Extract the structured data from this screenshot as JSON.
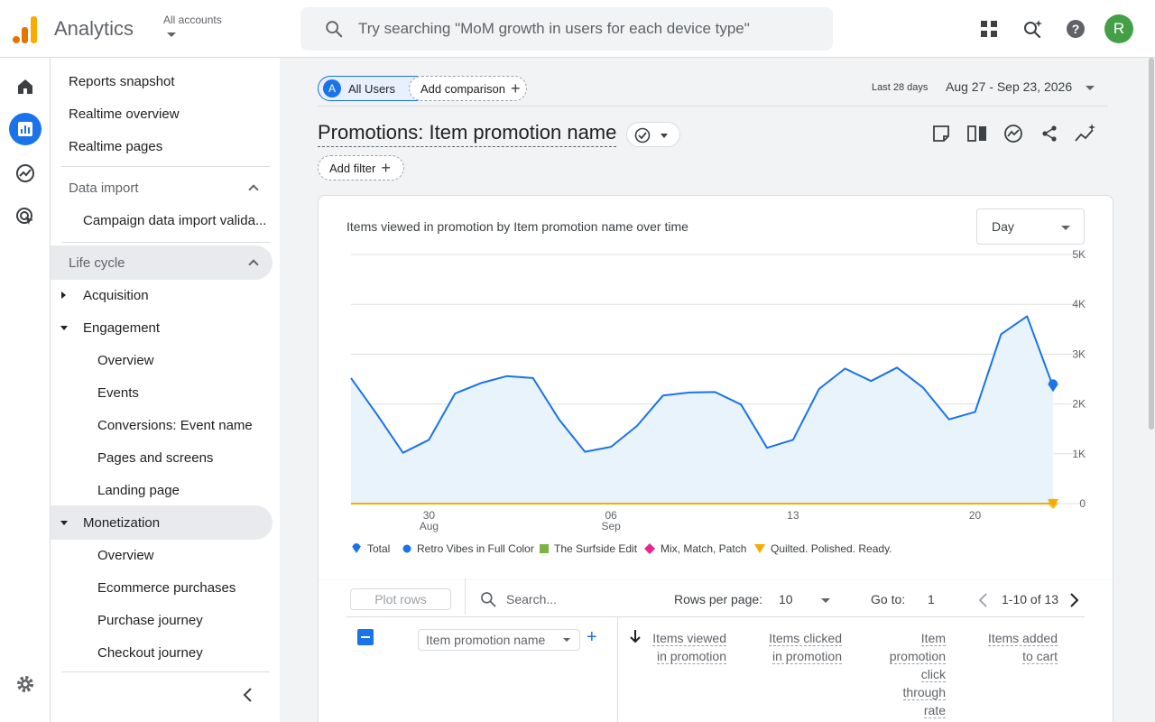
{
  "header": {
    "app_title": "Analytics",
    "accounts_label": "All accounts",
    "search_placeholder": "Try searching \"MoM growth in users for each device type\"",
    "avatar_initial": "R",
    "icons": [
      "apps-grid-icon",
      "search-insights-icon",
      "help-icon"
    ]
  },
  "rail": {
    "items": [
      "home-icon",
      "reports-icon",
      "explore-icon",
      "advertising-icon",
      "settings-icon"
    ],
    "active": "reports-icon"
  },
  "nav": {
    "top_items": [
      "Reports snapshot",
      "Realtime overview",
      "Realtime pages"
    ],
    "data_import_title": "Data import",
    "data_import_items": [
      "Campaign data import valida..."
    ],
    "lifecycle_title": "Life cycle",
    "acquisition": "Acquisition",
    "engagement": "Engagement",
    "engagement_items": [
      "Overview",
      "Events",
      "Conversions: Event name",
      "Pages and screens",
      "Landing page"
    ],
    "monetization": "Monetization",
    "monetization_items": [
      "Overview",
      "Ecommerce purchases",
      "Purchase journey",
      "Checkout journey"
    ]
  },
  "toolbar": {
    "segment_letter": "A",
    "segment_label": "All Users",
    "add_comparison": "Add comparison",
    "date_range_label": "Last 28 days",
    "date_range": "Aug 27 - Sep 23, 2026",
    "report_title": "Promotions: Item promotion name",
    "add_filter": "Add filter"
  },
  "chart_card": {
    "title": "Items viewed in promotion by Item promotion name over time",
    "granularity": "Day"
  },
  "chart_data": {
    "type": "line",
    "title": "Items viewed in promotion by Item promotion name over time",
    "x_tick_labels": [
      {
        "day": "30",
        "month": "Aug"
      },
      {
        "day": "06",
        "month": "Sep"
      },
      {
        "day": "13",
        "month": ""
      },
      {
        "day": "20",
        "month": ""
      }
    ],
    "y_tick_labels": [
      "0",
      "1K",
      "2K",
      "3K",
      "4K",
      "5K"
    ],
    "ylim": [
      0,
      5000
    ],
    "x": [
      "Aug 27",
      "Aug 28",
      "Aug 29",
      "Aug 30",
      "Aug 31",
      "Sep 1",
      "Sep 2",
      "Sep 3",
      "Sep 4",
      "Sep 5",
      "Sep 6",
      "Sep 7",
      "Sep 8",
      "Sep 9",
      "Sep 10",
      "Sep 11",
      "Sep 12",
      "Sep 13",
      "Sep 14",
      "Sep 15",
      "Sep 16",
      "Sep 17",
      "Sep 18",
      "Sep 19",
      "Sep 20",
      "Sep 21",
      "Sep 22",
      "Sep 23"
    ],
    "series": [
      {
        "name": "Total",
        "color": "#1a73e8",
        "fill": "#e8f3fc",
        "values": [
          2520,
          1790,
          1020,
          1280,
          2210,
          2420,
          2560,
          2520,
          1690,
          1040,
          1140,
          1560,
          2170,
          2230,
          2240,
          1990,
          1120,
          1280,
          2300,
          2710,
          2460,
          2730,
          2330,
          1690,
          1840,
          3400,
          3760,
          2350
        ]
      },
      {
        "name": "Retro Vibes in Full Color",
        "color": "#1a73e8",
        "values": [
          0,
          0,
          0,
          0,
          0,
          0,
          0,
          0,
          0,
          0,
          0,
          0,
          0,
          0,
          0,
          0,
          0,
          0,
          0,
          0,
          0,
          0,
          0,
          0,
          0,
          0,
          0,
          0
        ]
      },
      {
        "name": "The Surfside Edit",
        "color": "#7cb342",
        "values": [
          0,
          0,
          0,
          0,
          0,
          0,
          0,
          0,
          0,
          0,
          0,
          0,
          0,
          0,
          0,
          0,
          0,
          0,
          0,
          0,
          0,
          0,
          0,
          0,
          0,
          0,
          0,
          0
        ]
      },
      {
        "name": "Mix, Match, Patch",
        "color": "#e52592",
        "values": [
          0,
          0,
          0,
          0,
          0,
          0,
          0,
          0,
          0,
          0,
          0,
          0,
          0,
          0,
          0,
          0,
          0,
          0,
          0,
          0,
          0,
          0,
          0,
          0,
          0,
          0,
          0,
          0
        ]
      },
      {
        "name": "Quilted. Polished. Ready.",
        "color": "#f9ab00",
        "values": [
          0,
          0,
          0,
          0,
          0,
          0,
          0,
          0,
          0,
          0,
          0,
          0,
          0,
          0,
          0,
          0,
          0,
          0,
          0,
          0,
          0,
          0,
          0,
          0,
          0,
          0,
          0,
          0
        ]
      }
    ],
    "grid": true,
    "legend_position": "bottom-left"
  },
  "table": {
    "plot_rows": "Plot rows",
    "search_placeholder": "Search...",
    "rows_per_page_label": "Rows per page:",
    "rows_per_page": "10",
    "goto_label": "Go to:",
    "goto_value": "1",
    "page_info": "1-10 of 13",
    "dimension": "Item promotion name",
    "columns": [
      [
        "Items viewed",
        "in promotion"
      ],
      [
        "Items clicked",
        "in promotion"
      ],
      [
        "Item",
        "promotion",
        "click",
        "through",
        "rate"
      ],
      [
        "Items added",
        "to cart"
      ]
    ]
  }
}
